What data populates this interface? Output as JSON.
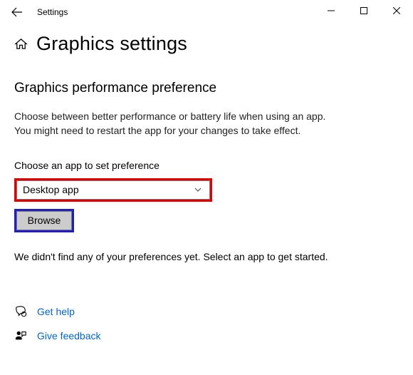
{
  "titlebar": {
    "label": "Settings"
  },
  "page": {
    "title": "Graphics settings",
    "section_title": "Graphics performance preference",
    "description_line1": "Choose between better performance or battery life when using an app.",
    "description_line2": "You might need to restart the app for your changes to take effect.",
    "field_label": "Choose an app to set preference",
    "dropdown_value": "Desktop app",
    "browse_label": "Browse",
    "status_text": "We didn't find any of your preferences yet. Select an app to get started."
  },
  "links": {
    "help": "Get help",
    "feedback": "Give feedback"
  }
}
